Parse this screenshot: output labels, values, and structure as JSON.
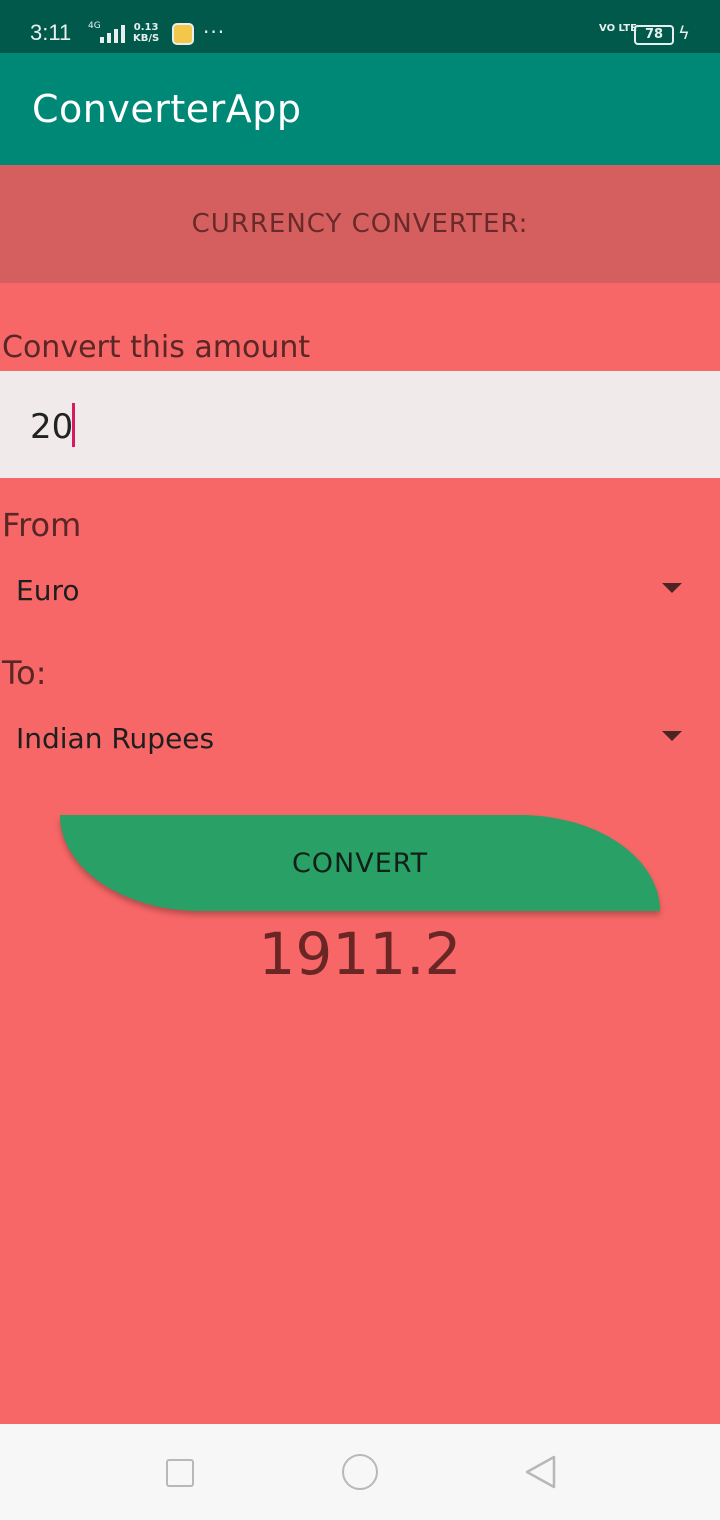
{
  "status_bar": {
    "time": "3:11",
    "network": "4G",
    "speed_value": "0.13",
    "speed_unit": "KB/S",
    "more": "···",
    "volte": "VO LTE",
    "battery": "78"
  },
  "app_bar": {
    "title": "ConverterApp"
  },
  "banner": {
    "title": "CURRENCY CONVERTER:"
  },
  "amount": {
    "label": "Convert this amount",
    "value": "20"
  },
  "from": {
    "label": "From",
    "selected": "Euro"
  },
  "to": {
    "label": "To:",
    "selected": "Indian Rupees"
  },
  "convert_button": {
    "label": "CONVERT"
  },
  "result": {
    "value": "1911.2"
  },
  "colors": {
    "status_bar": "#00594b",
    "app_bar": "#008877",
    "banner": "#d55f5e",
    "background": "#f76767",
    "input_background": "#f0eaea",
    "button": "#29a066",
    "cursor": "#d81b60"
  },
  "icons": {
    "nav_recents": "square-icon",
    "nav_home": "circle-icon",
    "nav_back": "triangle-back-icon",
    "dropdown": "caret-down-icon"
  }
}
